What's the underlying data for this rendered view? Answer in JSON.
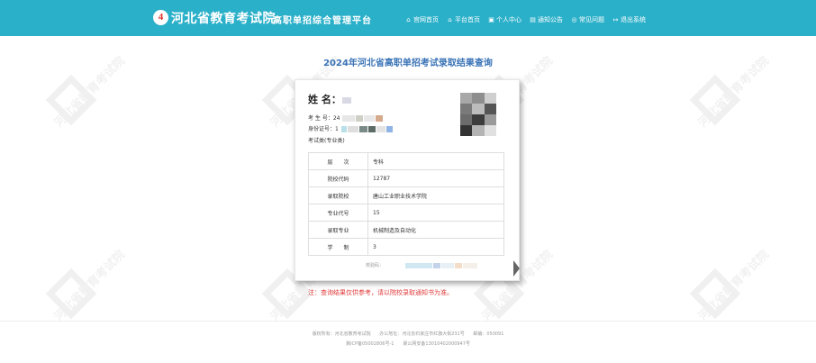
{
  "header": {
    "logo_glyph": "4",
    "org_name": "河北省教育考试院",
    "platform_name": "高职单招综合管理平台",
    "nav": [
      {
        "icon": "home-icon",
        "label": "官网首页"
      },
      {
        "icon": "home-icon",
        "label": "平台首页"
      },
      {
        "icon": "user-card-icon",
        "label": "个人中心"
      },
      {
        "icon": "document-icon",
        "label": "通知公告"
      },
      {
        "icon": "chat-icon",
        "label": "常见问题"
      },
      {
        "icon": "logout-icon",
        "label": "退出系统"
      }
    ]
  },
  "page": {
    "title": "2024年河北省高职单招考试录取结果查询"
  },
  "watermark": {
    "text": "河北省教育考试院"
  },
  "card": {
    "name_label": "姓 名：",
    "exam_no_label": "考 生 号：",
    "exam_no_prefix": "24",
    "id_label": "身份证号：",
    "id_prefix": "1",
    "category_label": "考试类(专业类)",
    "rows": [
      {
        "key": "层　　次",
        "value": "专科"
      },
      {
        "key": "院校代码",
        "value": "12787"
      },
      {
        "key": "录取院校",
        "value": "唐山工业职业技术学院"
      },
      {
        "key": "专业代号",
        "value": "15"
      },
      {
        "key": "录取专业",
        "value": "机械制造及自动化"
      },
      {
        "key": "学　　制",
        "value": "3"
      }
    ],
    "verify_label": "校验码："
  },
  "note": "注：查询结果仅供参考，请以院校录取通知书为准。",
  "footer": {
    "line1": [
      "版权所有：河北省教育考试院",
      "办公地址：河北省石家庄市红旗大街231号",
      "邮编：050091"
    ],
    "line2": "冀ICP备05002806号-1　　冀公网安备13010402000947号"
  },
  "colors": {
    "header_bg": "#2bb0c9",
    "title": "#3a73b6",
    "note": "#e03c3c"
  }
}
